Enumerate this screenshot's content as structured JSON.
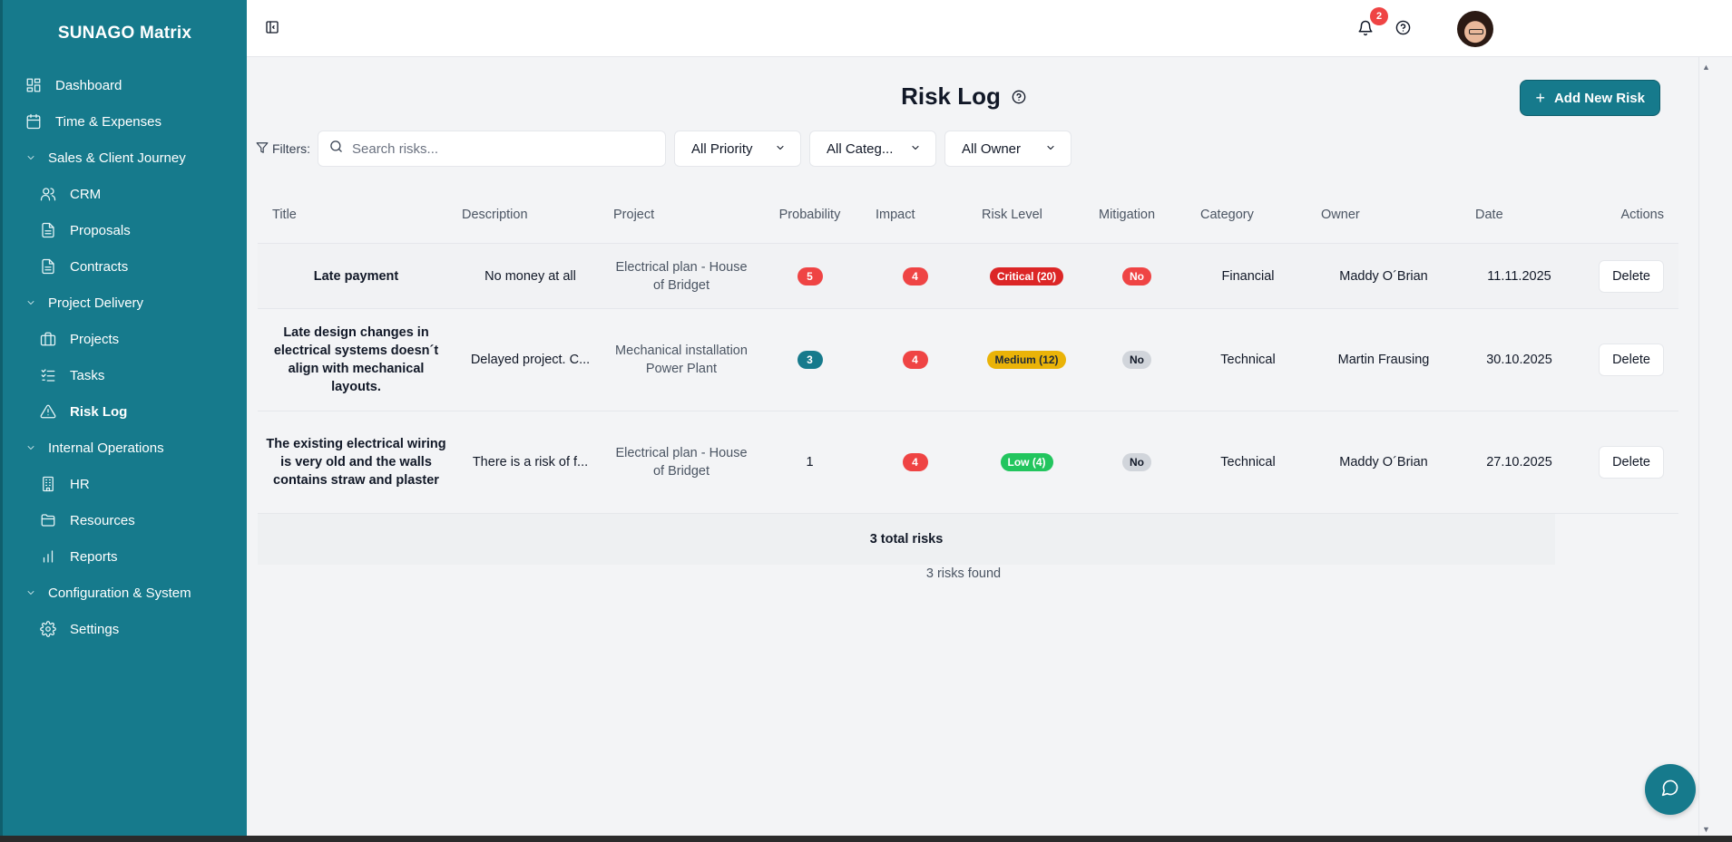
{
  "app": {
    "title": "SUNAGO Matrix"
  },
  "colors": {
    "brand": "#167a8c",
    "danger": "#ef4444",
    "warning": "#eab308",
    "success": "#22c55e"
  },
  "sidebar": {
    "items": [
      {
        "label": "Dashboard",
        "icon": "dashboard-icon"
      },
      {
        "label": "Time & Expenses",
        "icon": "calendar-icon"
      },
      {
        "label": "Sales & Client Journey",
        "icon": "chevron-down-icon"
      },
      {
        "label": "CRM",
        "icon": "users-icon"
      },
      {
        "label": "Proposals",
        "icon": "document-icon"
      },
      {
        "label": "Contracts",
        "icon": "document-icon"
      },
      {
        "label": "Project Delivery",
        "icon": "chevron-down-icon"
      },
      {
        "label": "Projects",
        "icon": "briefcase-icon"
      },
      {
        "label": "Tasks",
        "icon": "checklist-icon"
      },
      {
        "label": "Risk Log",
        "icon": "warning-icon"
      },
      {
        "label": "Internal Operations",
        "icon": "chevron-down-icon"
      },
      {
        "label": "HR",
        "icon": "building-icon"
      },
      {
        "label": "Resources",
        "icon": "folder-icon"
      },
      {
        "label": "Reports",
        "icon": "bar-chart-icon"
      },
      {
        "label": "Configuration & System",
        "icon": "chevron-down-icon"
      },
      {
        "label": "Settings",
        "icon": "gear-icon"
      }
    ]
  },
  "topbar": {
    "notifications_count": "2"
  },
  "page": {
    "title": "Risk Log",
    "add_button": "Add New Risk",
    "filters_label": "Filters:",
    "search_placeholder": "Search risks...",
    "priority_filter": "All Priority",
    "category_filter": "All Categ...",
    "owner_filter": "All Owner"
  },
  "table": {
    "headers": {
      "title": "Title",
      "description": "Description",
      "project": "Project",
      "probability": "Probability",
      "impact": "Impact",
      "risk_level": "Risk Level",
      "mitigation": "Mitigation",
      "category": "Category",
      "owner": "Owner",
      "date": "Date",
      "actions": "Actions"
    },
    "rows": [
      {
        "title": "Late payment",
        "description": "No money at all",
        "project": "Electrical plan - House of Bridget",
        "probability": "5",
        "impact": "4",
        "risk_level": "Critical (20)",
        "mitigation": "No",
        "category": "Financial",
        "owner": "Maddy O´Brian",
        "date": "11.11.2025",
        "action": "Delete"
      },
      {
        "title": "Late design changes in electrical systems doesn´t align with mechanical layouts.",
        "description": "Delayed project. C...",
        "project": "Mechanical installation Power Plant",
        "probability": "3",
        "impact": "4",
        "risk_level": "Medium (12)",
        "mitigation": "No",
        "category": "Technical",
        "owner": "Martin Frausing",
        "date": "30.10.2025",
        "action": "Delete"
      },
      {
        "title": "The existing electrical wiring is very old and the walls contains straw and plaster",
        "description": "There is a risk of f...",
        "project": "Electrical plan - House of Bridget",
        "probability": "1",
        "impact": "4",
        "risk_level": "Low (4)",
        "mitigation": "No",
        "category": "Technical",
        "owner": "Maddy O´Brian",
        "date": "27.10.2025",
        "action": "Delete"
      }
    ],
    "total": "3 total risks"
  },
  "found_text": "3 risks found"
}
